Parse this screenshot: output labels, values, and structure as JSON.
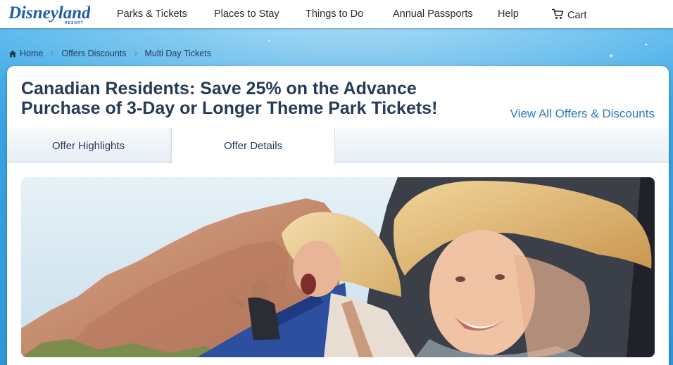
{
  "brand": {
    "logo_text": "Disneyland",
    "logo_subtext": "RESORT"
  },
  "nav": {
    "items": [
      {
        "label": "Parks & Tickets"
      },
      {
        "label": "Places to Stay"
      },
      {
        "label": "Things to Do"
      },
      {
        "label": "Annual Passports"
      },
      {
        "label": "Help"
      },
      {
        "label": "Cart",
        "icon": "cart-icon"
      }
    ]
  },
  "breadcrumb": {
    "home": "Home",
    "items": [
      "Offers Discounts",
      "Multi Day Tickets"
    ]
  },
  "offer": {
    "title": "Canadian Residents: Save 25% on the Advance Purchase of 3-Day or Longer Theme Park Tickets!",
    "view_all": "View All Offers & Discounts"
  },
  "tabs": [
    {
      "label": "Offer Highlights",
      "selected": false
    },
    {
      "label": "Offer Details",
      "selected": true
    }
  ],
  "hero_image": {
    "description": "photo"
  },
  "colors": {
    "accent": "#2a7bc0",
    "navy": "#253b56",
    "background": "#2f95da"
  }
}
